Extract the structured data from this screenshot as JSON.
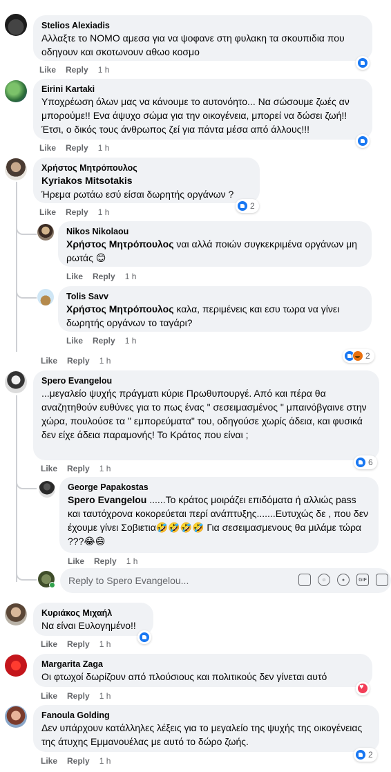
{
  "actions": {
    "like": "Like",
    "reply": "Reply",
    "time": "1 h"
  },
  "comments": [
    {
      "author": "Stelios Alexiadis",
      "text": "Αλλαξτε το ΝΟΜΟ αμεσα για να ψοφανε στη φυλακη τα σκουπιδια που οδηγουν και σκοτωνουν αθωο κοσμο",
      "reactions": {
        "types": [
          "like"
        ],
        "count": ""
      }
    },
    {
      "author": "Eirini Kartaki",
      "text": "Υποχρέωση όλων μας να κάνουμε το αυτονόητο... Να σώσουμε ζωές αν μπορούμε!! Ενα άψυχο σώμα για την οικογένεια, μπορεί να δώσει ζωή!! Έτσι, ο δικός τους άνθρωπος ζεί για πάντα μέσα από άλλους!!!",
      "reactions": {
        "types": [
          "like"
        ],
        "count": ""
      }
    },
    {
      "author": "Χρήστος Μητρόπουλος",
      "mention": "Kyriakos Mitsotakis",
      "text": "Ήρεμα ρωτάω εσύ είσαι δωρητής οργάνων ?",
      "reactions": {
        "types": [
          "like"
        ],
        "count": "2"
      }
    },
    {
      "author": "Nikos Nikolaou",
      "mention": "Χρήστος Μητρόπουλος",
      "text": "ναι αλλά ποιών συγκεκριμένα οργάνων μη ρωτάς 😊",
      "reactions": null
    },
    {
      "author": "Tolis Savv",
      "mention": "Χρήστος Μητρόπουλος",
      "text": "καλα, περιμένεις και εσυ τωρα να γίνει δωρητής οργάνων το ταγάρι?",
      "reactions": {
        "types": [
          "like",
          "angry"
        ],
        "count": "2"
      }
    },
    {
      "author": "Spero Evangelou",
      "text": "...μεγαλείο ψυχής πράγματι κύριε Πρωθυπουργέ. Από και πέρα θα αναζητηθούν ευθύνες για το πως ένας \" σεσειμασμένος \" μπαινόβγαινε στην χώρα, πουλούσε τα \" εμπορεύματα\" του, οδηγούσε χωρίς άδεια, και φυσικά δεν είχε άδεια παραμονής! Το Κράτος που είναι ;",
      "reactions": {
        "types": [
          "like"
        ],
        "count": "6"
      }
    },
    {
      "author": "George Papakostas",
      "mention": "Spero Evangelou",
      "text": "......Το κράτος μοιράζει επιδόματα ή αλλιώς pass και ταυτόχρονα κοκορεύεται περί ανάπτυξης.......Ευτυχώς δε , που δεν έχουμε γίνει Σοβιετια🤣🤣🤣🤣 Για σεσειμασμενους θα μιλάμε τώρα ???😂😄",
      "reactions": null
    },
    {
      "author": "Κυριάκος Μιχαήλ",
      "text": "Να είναι Ευλογημένο!!",
      "reactions": {
        "types": [
          "like"
        ],
        "count": ""
      }
    },
    {
      "author": "Margarita Zaga",
      "text": "Οι φτωχοί δωρίζουν από πλούσιους και πολιτικούς δεν γίνεται αυτό",
      "reactions": {
        "types": [
          "love"
        ],
        "count": ""
      }
    },
    {
      "author": "Fanoula Golding",
      "text": "Δεν υπάρχουν κατάλληλες λέξεις για το μεγαλείο της ψυχής της οικογένειας της άτυχης Εμμανουέλας με αυτό το δώρο ζωής.",
      "reactions": {
        "types": [
          "like"
        ],
        "count": "2"
      }
    }
  ],
  "reply_box": {
    "placeholder": "Reply to Spero Evangelou...",
    "icons": [
      "sticker-icon",
      "emoji-icon",
      "camera-icon",
      "gif-icon",
      "sticker-pack-icon"
    ]
  },
  "colors": {
    "bubble": "#f0f2f5",
    "meta": "#65676b",
    "like": "#1877f2",
    "love": "#f33e58"
  }
}
